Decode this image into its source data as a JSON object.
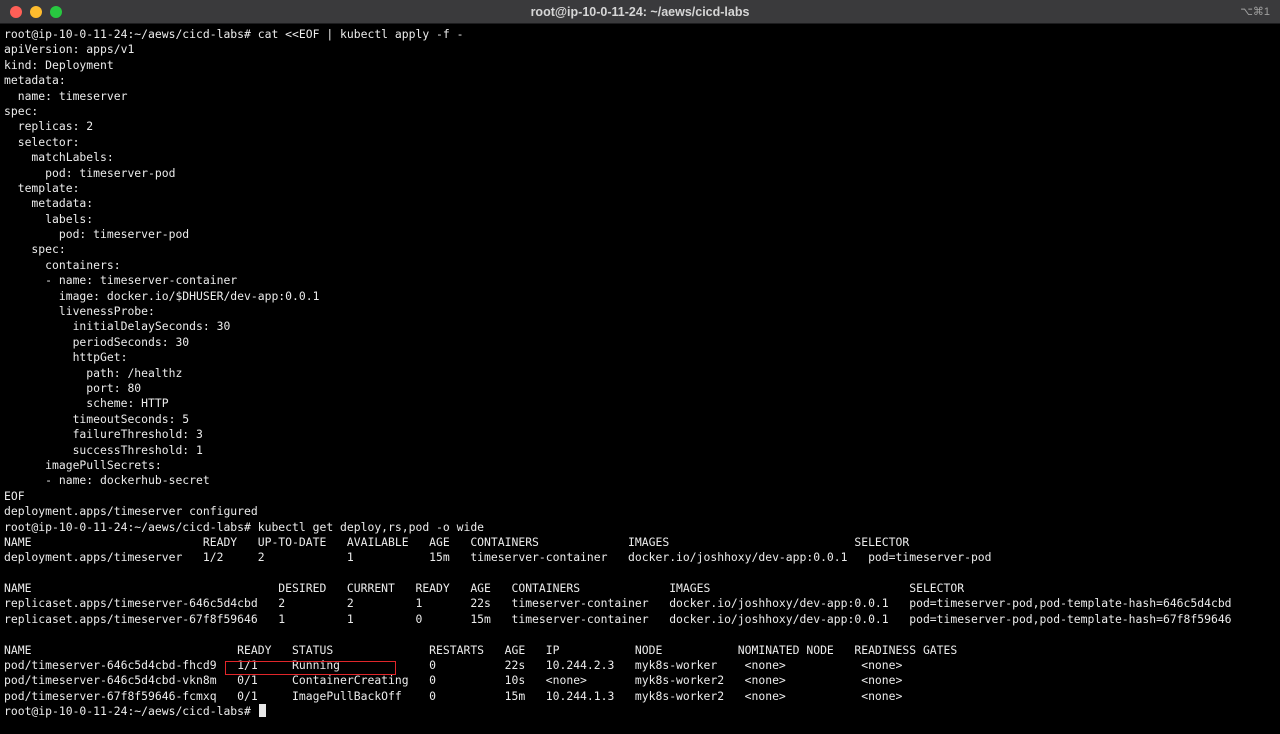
{
  "window": {
    "title": "root@ip-10-0-11-24: ~/aews/cicd-labs",
    "shortcut": "⌥⌘1"
  },
  "terminal": {
    "lines": [
      "root@ip-10-0-11-24:~/aews/cicd-labs# cat <<EOF | kubectl apply -f -",
      "apiVersion: apps/v1",
      "kind: Deployment",
      "metadata:",
      "  name: timeserver",
      "spec:",
      "  replicas: 2",
      "  selector:",
      "    matchLabels:",
      "      pod: timeserver-pod",
      "  template:",
      "    metadata:",
      "      labels:",
      "        pod: timeserver-pod",
      "    spec:",
      "      containers:",
      "      - name: timeserver-container",
      "        image: docker.io/$DHUSER/dev-app:0.0.1",
      "        livenessProbe:",
      "          initialDelaySeconds: 30",
      "          periodSeconds: 30",
      "          httpGet:",
      "            path: /healthz",
      "            port: 80",
      "            scheme: HTTP",
      "          timeoutSeconds: 5",
      "          failureThreshold: 3",
      "          successThreshold: 1",
      "      imagePullSecrets:",
      "      - name: dockerhub-secret",
      "EOF",
      "deployment.apps/timeserver configured",
      "root@ip-10-0-11-24:~/aews/cicd-labs# kubectl get deploy,rs,pod -o wide",
      "NAME                         READY   UP-TO-DATE   AVAILABLE   AGE   CONTAINERS             IMAGES                           SELECTOR",
      "deployment.apps/timeserver   1/2     2            1           15m   timeserver-container   docker.io/joshhoxy/dev-app:0.0.1   pod=timeserver-pod",
      "",
      "NAME                                    DESIRED   CURRENT   READY   AGE   CONTAINERS             IMAGES                             SELECTOR",
      "replicaset.apps/timeserver-646c5d4cbd   2         2         1       22s   timeserver-container   docker.io/joshhoxy/dev-app:0.0.1   pod=timeserver-pod,pod-template-hash=646c5d4cbd",
      "replicaset.apps/timeserver-67f8f59646   1         1         0       15m   timeserver-container   docker.io/joshhoxy/dev-app:0.0.1   pod=timeserver-pod,pod-template-hash=67f8f59646",
      "",
      "NAME                              READY   STATUS              RESTARTS   AGE   IP           NODE           NOMINATED NODE   READINESS GATES",
      "pod/timeserver-646c5d4cbd-fhcd9   1/1     Running             0          22s   10.244.2.3   myk8s-worker    <none>           <none>",
      "pod/timeserver-646c5d4cbd-vkn8m   0/1     ContainerCreating   0          10s   <none>       myk8s-worker2   <none>           <none>",
      "pod/timeserver-67f8f59646-fcmxq   0/1     ImagePullBackOff    0          15m   10.244.1.3   myk8s-worker2   <none>           <none>",
      "root@ip-10-0-11-24:~/aews/cicd-labs# "
    ]
  },
  "colors": {
    "background": "#000000",
    "text": "#ececec",
    "highlight": "#e0262a"
  }
}
